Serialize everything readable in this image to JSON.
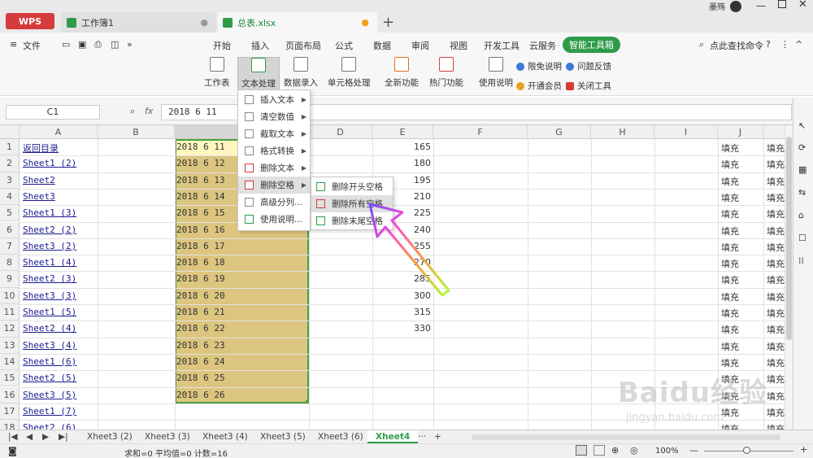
{
  "titlebar": {
    "wps_label": "WPS",
    "tab1": "工作簿1",
    "tab2": "总表.xlsx",
    "user": "墨殇"
  },
  "menubar": {
    "file": "文件",
    "items": [
      "开始",
      "插入",
      "页面布局",
      "公式",
      "数据",
      "审阅",
      "视图",
      "开发工具",
      "云服务"
    ],
    "active": "智能工具箱",
    "search": "点此查找命令"
  },
  "ribbon": {
    "buttons": [
      "工作表",
      "文本处理",
      "数据录入",
      "单元格处理",
      "全新功能",
      "热门功能",
      "使用说明"
    ],
    "small": [
      "限免说明",
      "问题反馈",
      "开通会员",
      "关闭工具"
    ]
  },
  "formula": {
    "namebox": "C1",
    "fx": "fx",
    "value": "2018 6 11"
  },
  "columns": [
    "A",
    "B",
    "C",
    "D",
    "E",
    "F",
    "G",
    "H",
    "I",
    "J"
  ],
  "rows": [
    "1",
    "2",
    "3",
    "4",
    "5",
    "6",
    "7",
    "8",
    "9",
    "10",
    "11",
    "12",
    "13",
    "14",
    "15",
    "16",
    "17",
    "18"
  ],
  "col_a": [
    "返回目录",
    "Sheet1 (2)",
    "Sheet2",
    "Sheet3",
    "Sheet1 (3)",
    "Sheet2 (2)",
    "Sheet3 (2)",
    "Sheet1 (4)",
    "Sheet2 (3)",
    "Sheet3 (3)",
    "Sheet1 (5)",
    "Sheet2 (4)",
    "Sheet3 (4)",
    "Sheet1 (6)",
    "Sheet2 (5)",
    "Sheet3 (5)",
    "Sheet1 (7)",
    "Sheet2 (6)"
  ],
  "col_c": [
    "2018 6 11",
    "2018 6 12",
    "2018 6 13",
    "2018 6 14",
    "2018 6 15",
    "2018 6 16",
    "2018 6 17",
    "2018 6 18",
    "2018 6 19",
    "2018 6 20",
    "2018 6 21",
    "2018 6 22",
    "2018 6 23",
    "2018 6 24",
    "2018 6 25",
    "2018 6 26"
  ],
  "col_e": [
    "165",
    "180",
    "195",
    "210",
    "225",
    "240",
    "255",
    "270",
    "285",
    "300",
    "315",
    "330"
  ],
  "fill_label": "填充",
  "dropdown": [
    "插入文本",
    "清空数值",
    "截取文本",
    "格式转换",
    "删除文本",
    "删除空格",
    "高级分列...",
    "使用说明..."
  ],
  "submenu": [
    "删除开头空格",
    "删除所有空格",
    "删除末尾空格"
  ],
  "sheets": [
    "Xheet3 (2)",
    "Xheet3 (3)",
    "Xheet3 (4)",
    "Xheet3 (5)",
    "Xheet3 (6)",
    "Xheet4"
  ],
  "status": {
    "summary": "求和=0  平均值=0  计数=16",
    "zoom": "100%"
  },
  "watermark": {
    "logo": "Baidu经验",
    "url": "jingyan.baidu.com"
  }
}
